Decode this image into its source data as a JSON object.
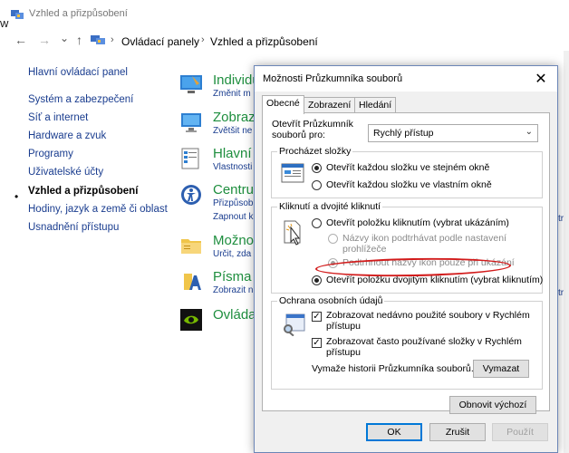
{
  "window": {
    "title": "Vzhled a přizpůsobení",
    "left_edge_char": "W"
  },
  "address": {
    "back": "←",
    "forward": "→",
    "dropdown": "⌄",
    "up": "↑",
    "crumbs": [
      "Ovládací panely",
      "Vzhled a přizpůsobení"
    ],
    "sep": "›"
  },
  "sidebar": {
    "items": [
      {
        "label": "Hlavní ovládací panel"
      },
      {
        "label": "Systém a zabezpečení"
      },
      {
        "label": "Síť a internet"
      },
      {
        "label": "Hardware a zvuk"
      },
      {
        "label": "Programy"
      },
      {
        "label": "Uživatelské účty"
      },
      {
        "label": "Vzhled a přizpůsobení"
      },
      {
        "label": "Hodiny, jazyk a země či oblast"
      },
      {
        "label": "Usnadnění přístupu"
      }
    ],
    "bullet": "•"
  },
  "categories": [
    {
      "title": "Individu",
      "link": "Změnit m",
      "link2": ""
    },
    {
      "title": "Zobraz",
      "link": "Zvětšit ne",
      "link2": ""
    },
    {
      "title": "Hlavní",
      "link": "Vlastnosti",
      "link2": ""
    },
    {
      "title": "Centrum",
      "link": "Přizpůsob",
      "link2": "Zapnout k"
    },
    {
      "title": "Možnos",
      "link": "Určit, zda",
      "link2": ""
    },
    {
      "title": "Písma",
      "link": "Zobrazit n",
      "link2": ""
    },
    {
      "title": "Ovládac",
      "link": "",
      "link2": ""
    }
  ],
  "edge_texts": [
    "tra",
    "tr"
  ],
  "dialog": {
    "title": "Možnosti Průzkumníka souborů",
    "close": "✕",
    "tabs": [
      "Obecné",
      "Zobrazení",
      "Hledání"
    ],
    "open_label_1": "Otevřít Průzkumník",
    "open_label_2": "souborů pro:",
    "open_value": "Rychlý přístup",
    "browse": {
      "title": "Procházet složky",
      "opt1": "Otevřít každou složku ve stejném okně",
      "opt2": "Otevřít každou složku ve vlastním okně"
    },
    "click": {
      "title": "Kliknutí a dvojité kliknutí",
      "opt1": "Otevřít položku kliknutím (vybrat ukázáním)",
      "sub1a": "Názvy ikon podtrhávat podle nastavení",
      "sub1b": "prohlížeče",
      "sub2": "Podtrhnout názvy ikon pouze při ukázání",
      "opt2": "Otevřít položku dvojitým kliknutím (vybrat kliknutím)"
    },
    "privacy": {
      "title": "Ochrana osobních údajů",
      "c1a": "Zobrazovat nedávno použité soubory v Rychlém",
      "c1b": "přístupu",
      "c2a": "Zobrazovat často používané složky v Rychlém",
      "c2b": "přístupu",
      "clear_label": "Vymaže historii Průzkumníka souborů.",
      "clear_button": "Vymazat",
      "check_mark": "✓"
    },
    "restore_button": "Obnovit výchozí",
    "ok": "OK",
    "cancel": "Zrušit",
    "apply": "Použít"
  }
}
